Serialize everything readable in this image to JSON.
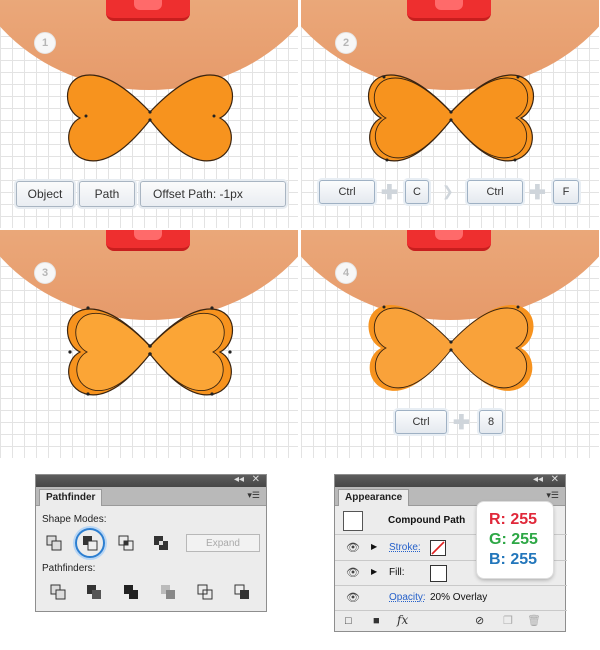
{
  "steps": {
    "s1": "1",
    "s2": "2",
    "s3": "3",
    "s4": "4"
  },
  "menu_path": {
    "object": "Object",
    "path": "Path",
    "offset": "Offset Path: -1px"
  },
  "shortcuts": {
    "ctrl": "Ctrl",
    "c": "C",
    "f": "F",
    "eight": "8"
  },
  "pathfinder": {
    "tab": "Pathfinder",
    "shape_modes": "Shape Modes:",
    "expand": "Expand",
    "pathfinders": "Pathfinders:"
  },
  "appearance": {
    "tab": "Appearance",
    "compound_path": "Compound Path",
    "stroke": "Stroke:",
    "fill": "Fill:",
    "opacity": "Opacity:",
    "opacity_value": "20% Overlay",
    "fx": "fx"
  },
  "color_tooltip": {
    "r": "R: 255",
    "g": "G: 255",
    "b": "B: 255"
  },
  "colors": {
    "bow_fill": "#F7931E",
    "red": "#E0283A",
    "green": "#2DA745",
    "blue": "#2276BB"
  },
  "icons": [
    "eye-icon",
    "expand-arrow-icon",
    "no-stroke-swatch-icon",
    "new-stroke-icon",
    "new-fill-icon",
    "clear-icon",
    "duplicate-icon",
    "delete-icon",
    "panel-menu-icon",
    "collapse-icon",
    "close-icon"
  ]
}
